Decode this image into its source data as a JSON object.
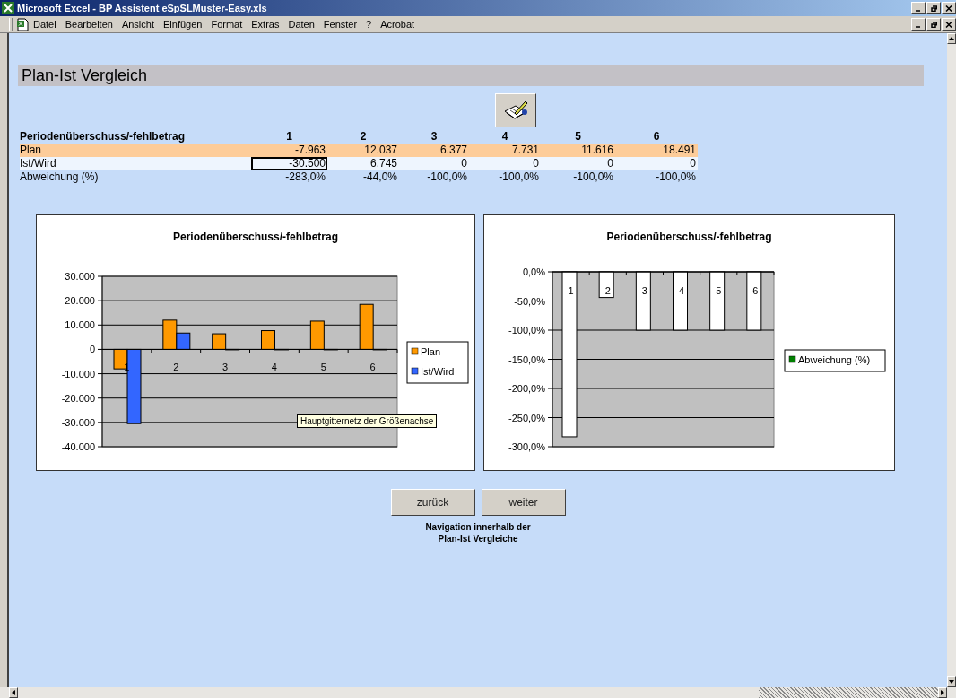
{
  "window": {
    "title": "Microsoft Excel - BP Assistent eSpSLMuster-Easy.xls"
  },
  "menu": [
    "Datei",
    "Bearbeiten",
    "Ansicht",
    "Einfügen",
    "Format",
    "Extras",
    "Daten",
    "Fenster",
    "?",
    "Acrobat"
  ],
  "sheet": {
    "heading": "Plan-Ist Vergleich",
    "table": {
      "title": "Periodenüberschuss/-fehlbetrag",
      "columns": [
        "1",
        "2",
        "3",
        "4",
        "5",
        "6"
      ],
      "rows": [
        {
          "kind": "plan",
          "label": "Plan",
          "cells": [
            {
              "text": "-7.963",
              "selected": false
            },
            {
              "text": "12.037",
              "selected": false
            },
            {
              "text": "6.377",
              "selected": false
            },
            {
              "text": "7.731",
              "selected": false
            },
            {
              "text": "11.616",
              "selected": false
            },
            {
              "text": "18.491",
              "selected": false
            }
          ]
        },
        {
          "kind": "actual",
          "label": "Ist/Wird",
          "cells": [
            {
              "text": "-30.500",
              "selected": true
            },
            {
              "text": "6.745",
              "selected": false
            },
            {
              "text": "0",
              "selected": false
            },
            {
              "text": "0",
              "selected": false
            },
            {
              "text": "0",
              "selected": false
            },
            {
              "text": "0",
              "selected": false
            }
          ]
        },
        {
          "kind": "deviation",
          "label": "Abweichung (%)",
          "cells": [
            {
              "text": "-283,0%",
              "selected": false
            },
            {
              "text": "-44,0%",
              "selected": false
            },
            {
              "text": "-100,0%",
              "selected": false
            },
            {
              "text": "-100,0%",
              "selected": false
            },
            {
              "text": "-100,0%",
              "selected": false
            },
            {
              "text": "-100,0%",
              "selected": false
            }
          ]
        }
      ]
    }
  },
  "charts": [
    {
      "tooltip": "Hauptgitternetz der Größenachse",
      "chart_data": {
        "type": "bar",
        "title": "Periodenüberschuss/-fehlbetrag",
        "categories": [
          "1",
          "2",
          "3",
          "4",
          "5",
          "6"
        ],
        "series": [
          {
            "name": "Plan",
            "color": "#ff9900",
            "values": [
              -8000,
              12000,
              6400,
              7700,
              11600,
              18500
            ]
          },
          {
            "name": "Ist/Wird",
            "color": "#3366ff",
            "values": [
              -30500,
              6700,
              0,
              0,
              0,
              0
            ]
          }
        ],
        "grid": true,
        "legend": true,
        "ylim": [
          -40000,
          30000
        ],
        "yticks": [
          {
            "value": 30000,
            "label": "30.000"
          },
          {
            "value": 20000,
            "label": "20.000"
          },
          {
            "value": 10000,
            "label": "10.000"
          },
          {
            "value": 0,
            "label": "0"
          },
          {
            "value": -10000,
            "label": "-10.000"
          },
          {
            "value": -20000,
            "label": "-20.000"
          },
          {
            "value": -30000,
            "label": "-30.000"
          },
          {
            "value": -40000,
            "label": "-40.000"
          }
        ]
      }
    },
    {
      "chart_data": {
        "type": "bar",
        "title": "Periodenüberschuss/-fehlbetrag",
        "categories": [
          "1",
          "2",
          "3",
          "4",
          "5",
          "6"
        ],
        "series": [
          {
            "name": "Abweichung (%)",
            "color": "#ffffff",
            "values": [
              -283,
              -44,
              -100,
              -100,
              -100,
              -100
            ]
          }
        ],
        "grid": true,
        "legend": true,
        "ylim": [
          -300,
          0
        ],
        "yticks": [
          {
            "value": 0,
            "label": "0,0%"
          },
          {
            "value": -50,
            "label": "-50,0%"
          },
          {
            "value": -100,
            "label": "-100,0%"
          },
          {
            "value": -150,
            "label": "-150,0%"
          },
          {
            "value": -200,
            "label": "-200,0%"
          },
          {
            "value": -250,
            "label": "-250,0%"
          },
          {
            "value": -300,
            "label": "-300,0%"
          }
        ]
      }
    }
  ],
  "navigation": {
    "buttons": [
      "zurück",
      "weiter"
    ],
    "caption": "Navigation innerhalb der Plan-Ist Vergleiche"
  }
}
